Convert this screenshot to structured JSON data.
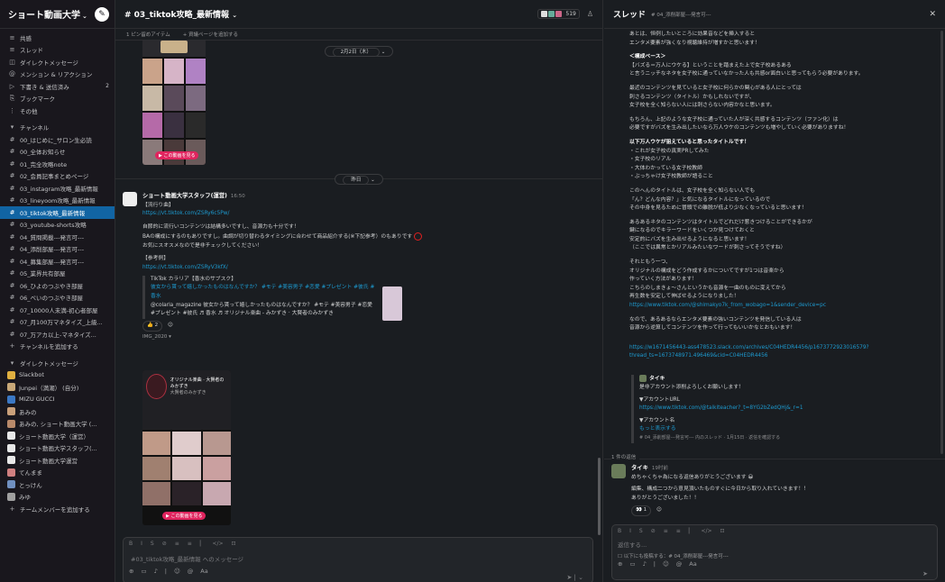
{
  "workspace": {
    "name": "ショート動画大学"
  },
  "sidebar": {
    "nav": [
      {
        "icon": "≡",
        "label": "共感",
        "name": "sidebar-item-huddles"
      },
      {
        "icon": "≡",
        "label": "スレッド",
        "name": "sidebar-item-threads"
      },
      {
        "icon": "◫",
        "label": "ダイレクトメッセージ",
        "name": "sidebar-item-dms"
      },
      {
        "icon": "@",
        "label": "メンション & リアクション",
        "name": "sidebar-item-mentions"
      },
      {
        "icon": "▷",
        "label": "下書き & 送信済み",
        "badge": "2",
        "name": "sidebar-item-drafts"
      },
      {
        "icon": "⎘",
        "label": "ブックマーク",
        "name": "sidebar-item-bookmarks"
      },
      {
        "icon": "⋮",
        "label": "その他",
        "name": "sidebar-item-more"
      }
    ],
    "channels_header": "チャンネル",
    "channels": [
      "00_はじめに_サロン生必読",
      "00_全体お知らせ",
      "01_完全攻略note",
      "02_会員記事まとめページ",
      "03_instagram攻略_最新情報",
      "03_lineyoom攻略_最新情報",
      "03_tiktok攻略_最新情報",
      "03_youtube-shorts攻略",
      "04_質問掲載---発言可---",
      "04_添削部屋---発言可---",
      "04_募集部屋---発言可---",
      "05_業界共有部屋",
      "06_ひよのつぶやき部屋",
      "06_べいのつぶやき部屋",
      "07_10000人未満-初心者部屋",
      "07_月100万マネタイズ_上級...",
      "07_万アカ以上-マネタイズ..."
    ],
    "active_channel_index": 6,
    "add_channel": "チャンネルを追加する",
    "dm_header": "ダイレクトメッセージ",
    "dms": [
      {
        "label": "Slackbot",
        "color": "#e0b040"
      },
      {
        "label": "Junpei（満潮） (自分)",
        "color": "#c8a878"
      },
      {
        "label": "MIZU GUCCI",
        "color": "#3b78c4"
      },
      {
        "label": "あみの",
        "color": "#c9a07a"
      },
      {
        "label": "あみの, ショート動画大学 (...",
        "color": "#b98a6a"
      },
      {
        "label": "ショート動画大学（運営）",
        "color": "#e8e8e8"
      },
      {
        "label": "ショート動画大学スタッフ(...",
        "color": "#e8e8e8"
      },
      {
        "label": "ショート動画大学運営",
        "color": "#e8e8e8"
      },
      {
        "label": "てんまま",
        "color": "#d08080"
      },
      {
        "label": "とっけん",
        "color": "#7090c0"
      },
      {
        "label": "みゆ",
        "color": "#a0a0a0"
      }
    ],
    "add_member": "チームメンバーを追加する"
  },
  "channel": {
    "title": "# 03_tiktok攻略_最新情報",
    "member_count": "519",
    "bookmarks": [
      "1 ピン留めアイテム",
      "+ 資議ページを追加する"
    ],
    "date1": "2月2日（木）",
    "date2": "昨日",
    "thumb_button": "この動画を見る",
    "message": {
      "author": "ショート動画大学スタッフ(運営)",
      "time": "16:50",
      "lines": [
        "【流行り曲】",
        "https://vt.tiktok.com/ZSRy6c5Pw/",
        "自節的に流行いコンテンツは結構多いですし、音源力も十分です！",
        "BAの構成にするのもありですし。曲調が切り替わるタイミングに合わせて商品紹介する(※下記参考）のもありです",
        "お気にスオスメなので是非チェックしてください！",
        "【参考例】",
        "https://vt.tiktok.com/ZSRyV3kfX/"
      ],
      "tiktok_source": "TikTok カラリア【香水のサブスク】",
      "tiktok_title": "彼女から貰って嬉しかったものはなんですか？ #モテ #美容男子 #恋愛 #プレゼント #彼氏 #香水",
      "tiktok_desc": "@colaria_magazine 彼女から貰って嬉しかったものはなんですか？ #モテ #美容男子 #恋愛 #プレゼント #彼氏 ♬ 香水 ♬ オリジナル楽曲 - みかずき · 大賢者のみかずき",
      "reaction_emoji": "👍",
      "reaction_count": "2",
      "file_label": "IMG_2020 ▾",
      "thumb_title": "オリジナル楽曲 · 大賢者のみかずき",
      "thumb_sub": "大賢者のみかずき"
    },
    "composer_placeholder": "#03_tiktok攻略_最新情報 へのメッセージ"
  },
  "thread": {
    "title": "スレッド",
    "subtitle": "# 04_添削部屋---発言可---",
    "lines": [
      {
        "t": "あとは、恒例したいところに効果音などを挿入すると"
      },
      {
        "t": "エンタメ要素が強くなり視聴維持が増すかと思います！"
      },
      {
        "t": "",
        "gap": true
      },
      {
        "t": "＜構成ベース＞",
        "bold": true
      },
      {
        "t": "【バズる＝万人にウケる】ということを踏まえた上で女子校あるある"
      },
      {
        "t": "と言うニッチなネタを女子校に通っていなかった人も共感or面白いと思ってもらう必要があります。"
      },
      {
        "t": "",
        "gap": true
      },
      {
        "t": "最近のコンテンツを見ていると女子校に何らかの関心がある人にとっては"
      },
      {
        "t": "刺さるコンテンツ（タイトル）かもしれないですが、"
      },
      {
        "t": "女子校を全く知らない人には刺さらない内容かなと思います。"
      },
      {
        "t": "",
        "gap": true
      },
      {
        "t": "もちろん、上記のような女子校に通っていた人が深く共感するコンテンツ（ファン化）は"
      },
      {
        "t": "必要ですがバズを生み出したいなら万人ウケのコンテンツも増やしていく必要がありますね！"
      },
      {
        "t": "",
        "gap": true
      },
      {
        "t": "以下万人ウケが狙えていると思ったタイトルです！",
        "bold": true
      },
      {
        "t": "・これが女子校の真実PRしてみた"
      },
      {
        "t": "・女子校のリアル"
      },
      {
        "t": "・大体わかっている女子校教師"
      },
      {
        "t": "・ぶっちゃけ女子校教師が語ること"
      },
      {
        "t": "",
        "gap": true
      },
      {
        "t": "このへんのタイトルは、女子校を全く知らない人でも"
      },
      {
        "t": "「ん？どんな内容？」と気になるタイトルになっているので"
      },
      {
        "t": "その中身を見るために冒頭での離脱が低より少なくなっていると思います！"
      },
      {
        "t": "",
        "gap": true
      },
      {
        "t": "あるあるネタのコンテンツはタイトルでどれだけ惹きつけることができるかが"
      },
      {
        "t": "鍵になるのでキラーワードをいくつか見つけておくと"
      },
      {
        "t": "安定的にバズを生み出せるようになると思います！"
      },
      {
        "t": "（ここでは異常とかリアルみたいなワードが刺さってそうですね）"
      },
      {
        "t": "",
        "gap": true
      },
      {
        "t": "それともう一つ、"
      },
      {
        "t": "オリジナルの構成をどう作成するかについてですが1つは音楽から"
      },
      {
        "t": "作っていく方法があります！"
      },
      {
        "t": "こちらのしまきょ〜さんというかも音源を一曲のものに変えてから"
      },
      {
        "t": "再生数を安定して伸ばせるようになりました！"
      },
      {
        "t": "https://www.tiktok.com/@shimakyo7k_from_wobago=1&sender_device=pc",
        "link": true
      },
      {
        "t": "",
        "gap": true
      },
      {
        "t": "なので、あるあるならエンタメ要素の強いコンテンツを発信している人は"
      },
      {
        "t": "音源から逆算してコンテンツを作って行ってもいいかなとおもいます！"
      },
      {
        "t": "",
        "gap": true
      },
      {
        "t": "",
        "gap": true
      },
      {
        "t": "https://w1671456443-ass478523.slack.com/archives/C04HEDR4456/p1673772923016579?",
        "link": true
      },
      {
        "t": "thread_ts=1673748971.496469&cid=C04HEDR4456",
        "link": true
      }
    ],
    "quote": {
      "author": "タイキ",
      "line1": "是非アカウント添削よろしくお願いします！",
      "line2": "▼アカウントURL",
      "url": "https://www.tiktok.com/@taikiteacher?_t=8YG2bZedQHj&_r=1",
      "line3": "▼アカウント名",
      "more": "もっと表示する",
      "foot": "# 04_添削部屋---発言可--- 内のスレッド · 1月15日 · 返信を確認する"
    },
    "reply_count": "1 件の返信",
    "reply": {
      "author": "タイキ",
      "time": "19时前",
      "line1": "めちゃくちゃ為になる返信ありがとうございます 😀",
      "line2": "編集、構成二つから意見頂いたものすぐに今日から取り入れていきます！！",
      "line3": "ありがとうございました！！",
      "reaction": "👀",
      "reaction_count": "1"
    },
    "reply_placeholder": "返信する...",
    "also_send": "以下にも投稿する：# 04_添削部屋---発言可---"
  }
}
